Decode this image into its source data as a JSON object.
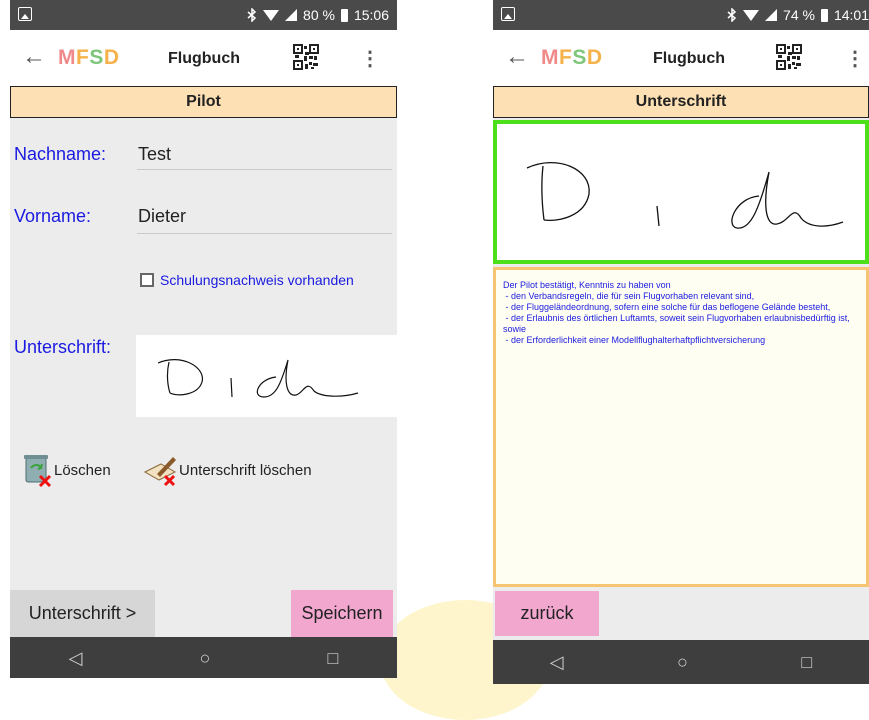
{
  "colors": {
    "label_blue": "#1a1ae0",
    "section_bg": "#fde0b3",
    "accent_pink": "#f2a7cf",
    "signature_border_green": "#4be01a",
    "declaration_border": "#f5c572"
  },
  "left_screen": {
    "status": {
      "battery": "80 %",
      "time": "15:06"
    },
    "appbar": {
      "logo": "MFSD",
      "title": "Flugbuch"
    },
    "section_title": "Pilot",
    "form": {
      "nachname_label": "Nachname:",
      "nachname_value": "Test",
      "vorname_label": "Vorname:",
      "vorname_value": "Dieter",
      "schulung_label": "Schulungsnachweis vorhanden",
      "schulung_checked": false,
      "unterschrift_label": "Unterschrift:"
    },
    "actions": {
      "delete_label": "Löschen",
      "delete_signature_label": "Unterschrift löschen"
    },
    "buttons": {
      "next_label": "Unterschrift >",
      "save_label": "Speichern"
    }
  },
  "right_screen": {
    "status": {
      "battery": "74 %",
      "time": "14:01"
    },
    "appbar": {
      "logo": "MFSD",
      "title": "Flugbuch"
    },
    "section_title": "Unterschrift",
    "declaration": [
      "Der Pilot bestätigt, Kenntnis zu haben von",
      " - den Verbandsregeln, die für sein Flugvorhaben relevant sind,",
      " - der Fluggeländeordnung, sofern eine solche für das beflogene Gelände besteht,",
      " - der Erlaubnis des örtlichen Luftamts, soweit sein Flugvorhaben erlaubnisbedürftig ist, sowie",
      " - der Erforderlichkeit einer Modellflughalterhaftpflichtversicherung"
    ],
    "buttons": {
      "back_label": "zurück"
    }
  }
}
